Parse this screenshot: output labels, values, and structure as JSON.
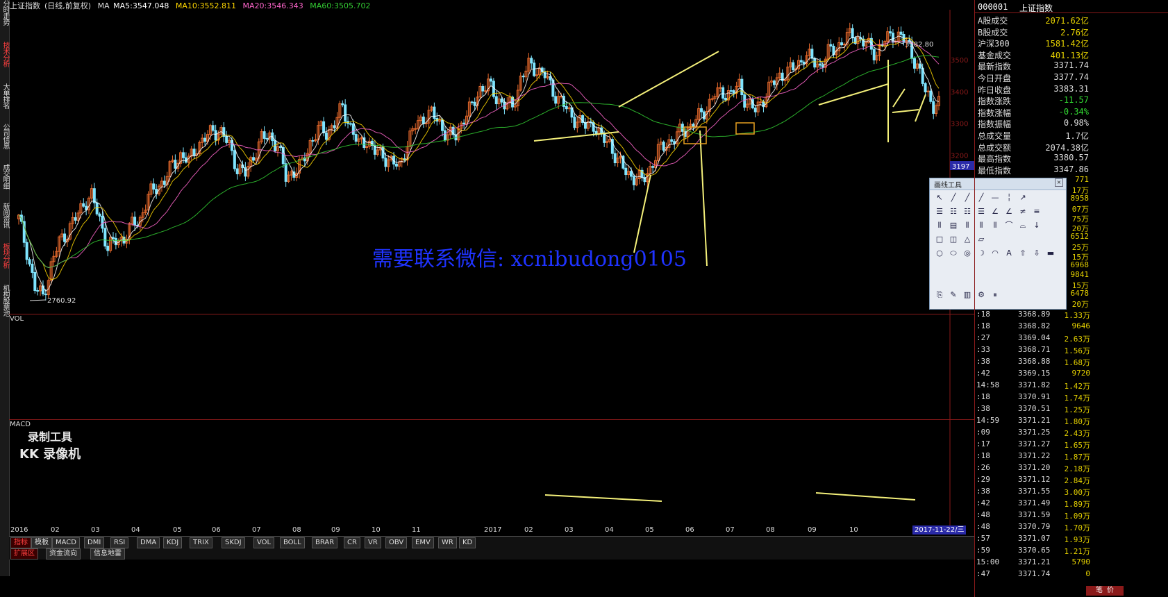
{
  "header": {
    "title": "上证指数",
    "subtitle": "(日线,前复权)",
    "ma_label": "MA",
    "ma5": "MA5:3547.048",
    "ma10": "MA10:3552.811",
    "ma20": "MA20:3546.343",
    "ma60": "MA60:3505.702"
  },
  "colors": {
    "ma5": "#ffffff",
    "ma10": "#ffd700",
    "ma20": "#ff66cc",
    "ma60": "#33cc33",
    "up": "#e86a2c",
    "down": "#7fe5ff",
    "grid": "#8b1a1a",
    "annotation": "#f4f07a",
    "watermark": "#1f33ff"
  },
  "left_tabs": [
    {
      "label": "分时走势",
      "active": false
    },
    {
      "label": "技术分析",
      "active": true
    },
    {
      "label": "大单排名",
      "active": false
    },
    {
      "label": "公司信息",
      "active": false
    },
    {
      "label": "成交明细",
      "active": false
    },
    {
      "label": "新闻资讯",
      "active": false
    },
    {
      "label": "板块分析",
      "active": true
    },
    {
      "label": "机构股票池",
      "active": false
    }
  ],
  "panels": {
    "vol_label": "VOL",
    "macd_label": "MACD"
  },
  "chart_data": {
    "type": "candlestick",
    "title": "上证指数",
    "price_labels": {
      "high": "3582.80",
      "low": "2760.92"
    },
    "y_axis_ticks": [
      "3500",
      "3400",
      "3300",
      "3200"
    ],
    "current_price_tag": "3197",
    "x_labels": [
      "2016",
      "02",
      "03",
      "04",
      "05",
      "06",
      "07",
      "08",
      "09",
      "10",
      "11",
      "2017",
      "02",
      "03",
      "04",
      "05",
      "06",
      "07",
      "08",
      "09",
      "10"
    ],
    "date_tag": "2017-11-22/三",
    "price_path": [
      3000,
      2900,
      2780,
      2760,
      2850,
      2930,
      2960,
      3000,
      3050,
      3070,
      3000,
      2910,
      2930,
      2940,
      2980,
      3000,
      3070,
      3100,
      3120,
      3170,
      3200,
      3180,
      3230,
      3250,
      3280,
      3270,
      3230,
      3160,
      3140,
      3200,
      3250,
      3260,
      3230,
      3130,
      3150,
      3170,
      3240,
      3280,
      3270,
      3300,
      3350,
      3290,
      3230,
      3250,
      3210,
      3200,
      3180,
      3160,
      3240,
      3290,
      3320,
      3330,
      3300,
      3260,
      3260,
      3320,
      3350,
      3410,
      3420,
      3380,
      3360,
      3350,
      3440,
      3480,
      3470,
      3450,
      3400,
      3370,
      3330,
      3310,
      3290,
      3300,
      3250,
      3240,
      3180,
      3150,
      3130,
      3120,
      3160,
      3210,
      3240,
      3250,
      3280,
      3290,
      3320,
      3350,
      3390,
      3400,
      3390,
      3420,
      3360,
      3340,
      3380,
      3420,
      3450,
      3460,
      3480,
      3510,
      3500,
      3480,
      3520,
      3540,
      3560,
      3580,
      3560,
      3540,
      3520,
      3560,
      3580,
      3570,
      3540,
      3480,
      3400,
      3360
    ],
    "annotation_text": "需要联系微信: xcnibudong0105"
  },
  "right_panel": {
    "code": "000001",
    "name": "上证指数",
    "stats": [
      {
        "label": "A股成交",
        "value": "2071.62亿"
      },
      {
        "label": "B股成交",
        "value": "2.76亿"
      },
      {
        "label": "沪深300",
        "value": "1581.42亿"
      },
      {
        "label": "基金成交",
        "value": "401.13亿"
      },
      {
        "label": "最新指数",
        "value": "3371.74"
      },
      {
        "label": "今日开盘",
        "value": "3377.74"
      },
      {
        "label": "昨日收盘",
        "value": "3383.31"
      },
      {
        "label": "指数涨跌",
        "value": "-11.57"
      },
      {
        "label": "指数涨幅",
        "value": "-0.34%"
      },
      {
        "label": "指数振幅",
        "value": "0.98%"
      },
      {
        "label": "总成交量",
        "value": "1.7亿"
      },
      {
        "label": "总成交额",
        "value": "2074.38亿"
      },
      {
        "label": "最高指数",
        "value": "3380.57"
      },
      {
        "label": "最低指数",
        "value": "3347.86"
      }
    ],
    "partial_volumes": [
      "771",
      "17万",
      "8958",
      "07万",
      "75万",
      "20万",
      "6512",
      "25万",
      "15万",
      "6968",
      "9841",
      "15万",
      "6478",
      "20万"
    ],
    "ticks": [
      {
        "t": ":18",
        "p": "3368.89",
        "v": "1.33万"
      },
      {
        "t": ":18",
        "p": "3368.82",
        "v": "9646"
      },
      {
        "t": ":27",
        "p": "3369.04",
        "v": "2.63万"
      },
      {
        "t": ":33",
        "p": "3368.71",
        "v": "1.56万"
      },
      {
        "t": ":38",
        "p": "3368.88",
        "v": "1.68万"
      },
      {
        "t": ":42",
        "p": "3369.15",
        "v": "9720"
      },
      {
        "t": "14:58",
        "p": "3371.82",
        "v": "1.42万"
      },
      {
        "t": ":18",
        "p": "3370.91",
        "v": "1.74万"
      },
      {
        "t": ":38",
        "p": "3370.51",
        "v": "1.25万"
      },
      {
        "t": "14:59",
        "p": "3371.21",
        "v": "1.80万"
      },
      {
        "t": ":09",
        "p": "3371.25",
        "v": "2.43万"
      },
      {
        "t": ":17",
        "p": "3371.27",
        "v": "1.65万"
      },
      {
        "t": ":18",
        "p": "3371.22",
        "v": "1.87万"
      },
      {
        "t": ":26",
        "p": "3371.20",
        "v": "2.18万"
      },
      {
        "t": ":29",
        "p": "3371.12",
        "v": "2.84万"
      },
      {
        "t": ":38",
        "p": "3371.55",
        "v": "3.00万"
      },
      {
        "t": ":42",
        "p": "3371.49",
        "v": "1.89万"
      },
      {
        "t": ":48",
        "p": "3371.59",
        "v": "1.09万"
      },
      {
        "t": ":48",
        "p": "3370.79",
        "v": "1.70万"
      },
      {
        "t": ":57",
        "p": "3371.07",
        "v": "1.93万"
      },
      {
        "t": ":59",
        "p": "3370.65",
        "v": "1.21万"
      },
      {
        "t": "15:00",
        "p": "3371.21",
        "v": "5790"
      },
      {
        "t": ":47",
        "p": "3371.74",
        "v": "0"
      }
    ],
    "bottom_button": "笔  价"
  },
  "bottom_tabs": [
    {
      "label": "指标",
      "active": true
    },
    {
      "label": "模板",
      "active": false
    },
    {
      "label": "MACD",
      "active": false
    },
    {
      "label": "DMI",
      "active": false
    },
    {
      "label": "RSI",
      "active": false
    },
    {
      "label": "DMA",
      "active": false
    },
    {
      "label": "KDJ",
      "active": false
    },
    {
      "label": "TRIX",
      "active": false
    },
    {
      "label": "SKDJ",
      "active": false
    },
    {
      "label": "VOL",
      "active": false
    },
    {
      "label": "BOLL",
      "active": false
    },
    {
      "label": "BRAR",
      "active": false
    },
    {
      "label": "CR",
      "active": false
    },
    {
      "label": "VR",
      "active": false
    },
    {
      "label": "OBV",
      "active": false
    },
    {
      "label": "EMV",
      "active": false
    },
    {
      "label": "WR",
      "active": false
    },
    {
      "label": "KD",
      "active": false
    }
  ],
  "bottom_tabs2": [
    {
      "label": "扩展区"
    },
    {
      "label": "资金流向"
    },
    {
      "label": "信息地雷"
    }
  ],
  "toolbox": {
    "title": "画线工具"
  },
  "watermark": {
    "line1": "录制工具",
    "line2": "KK 录像机"
  }
}
